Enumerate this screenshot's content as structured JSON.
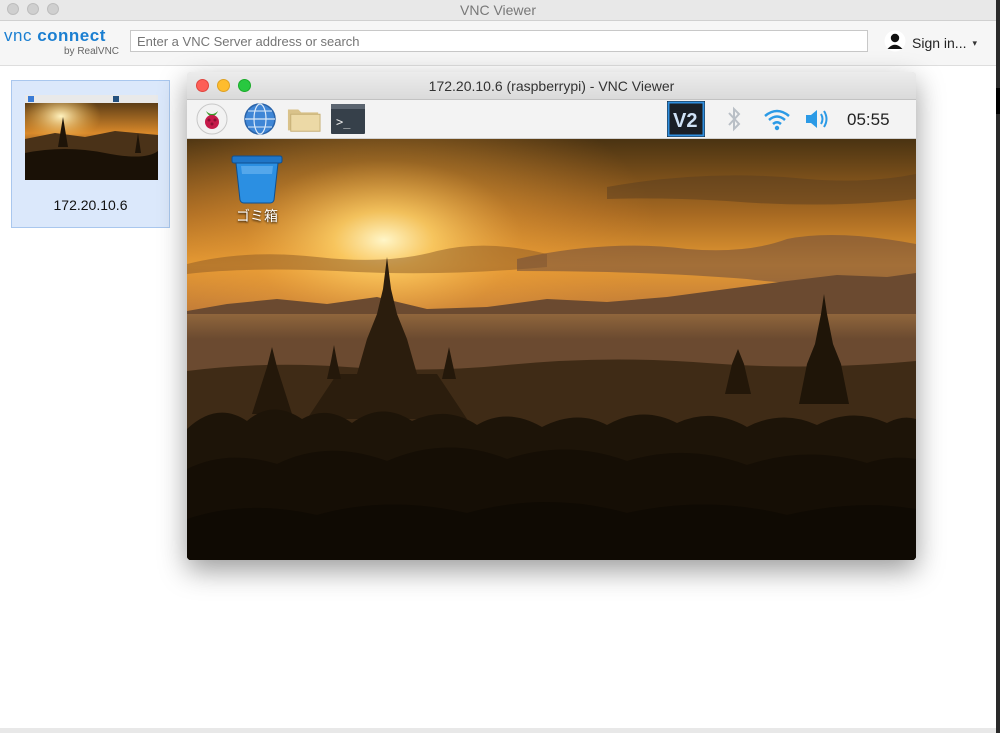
{
  "app": {
    "window_title": "VNC Viewer"
  },
  "toolbar": {
    "logo_prefix": "vnc",
    "logo_brand": "connect",
    "logo_byline": "by RealVNC",
    "search_placeholder": "Enter a VNC Server address or search",
    "signin_label": "Sign in...",
    "signin_caret": "▾"
  },
  "address_book": {
    "items": [
      {
        "label": "172.20.10.6"
      }
    ]
  },
  "session": {
    "window_title": "172.20.10.6 (raspberrypi) - VNC Viewer",
    "panel": {
      "left_icons": [
        "raspberry-menu-icon",
        "web-browser-icon",
        "file-manager-icon",
        "terminal-icon"
      ],
      "terminal_glyph": ">_",
      "right_icons": [
        "vnc-icon",
        "bluetooth-icon",
        "wifi-icon",
        "volume-icon"
      ],
      "vnc_glyph": "V2",
      "clock": "05:55"
    },
    "desktop": {
      "icons": [
        {
          "name": "trash-icon",
          "label": "ゴミ箱"
        }
      ]
    }
  },
  "colors": {
    "brand_blue": "#1b7fd1",
    "card_selected_bg": "#dbe8fb",
    "close_red": "#fd5f57",
    "minimize_yellow": "#febc2e",
    "zoom_green": "#28c840"
  }
}
